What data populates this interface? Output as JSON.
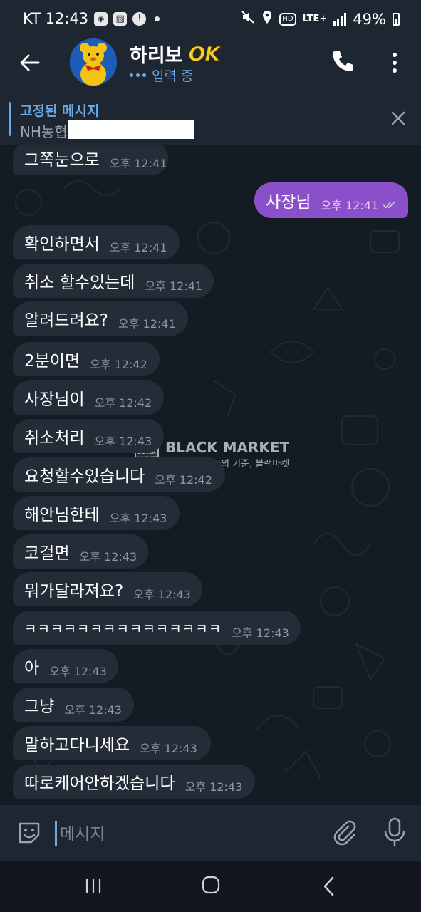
{
  "status_bar": {
    "carrier_time": "KT 12:43",
    "network": "LTE+",
    "hd": "HD",
    "battery": "49%"
  },
  "header": {
    "title": "하리보",
    "badge": "OK",
    "status": "입력 중"
  },
  "pinned": {
    "title": "고정된 메시지",
    "preview": "NH농협"
  },
  "messages": [
    {
      "text": "그쪽눈으로",
      "time": "오후 12:41"
    },
    {
      "text": "사장님",
      "time": "오후 12:41",
      "outgoing": true
    },
    {
      "text": "확인하면서",
      "time": "오후 12:41"
    },
    {
      "text": "취소 할수있는데",
      "time": "오후 12:41"
    },
    {
      "text": "알려드려요?",
      "time": "오후 12:41"
    },
    {
      "text": "2분이면",
      "time": "오후 12:42"
    },
    {
      "text": "사장님이",
      "time": "오후 12:42"
    },
    {
      "text": "취소처리",
      "time": "오후 12:43"
    },
    {
      "text": "요청할수있습니다",
      "time": "오후 12:42"
    },
    {
      "text": "해안님한테",
      "time": "오후 12:43"
    },
    {
      "text": "코걸면",
      "time": "오후 12:43"
    },
    {
      "text": "뭐가달라져요?",
      "time": "오후 12:43"
    },
    {
      "text": "ㅋㅋㅋㅋㅋㅋㅋㅋㅋㅋㅋㅋㅋㅋㅋ",
      "time": "오후 12:43"
    },
    {
      "text": "아",
      "time": "오후 12:43"
    },
    {
      "text": "그냥",
      "time": "오후 12:43"
    },
    {
      "text": "말하고다니세요",
      "time": "오후 12:43"
    },
    {
      "text": "따로케어안하겠습니다",
      "time": "오후 12:43"
    }
  ],
  "watermark": {
    "logo_text": "BLACK MARKET",
    "title": "BLACK MARKET",
    "subtitle": "정보의 기준, 블랙마켓"
  },
  "input": {
    "placeholder": "메시지"
  },
  "colors": {
    "accent": "#6aa9e6",
    "outgoing_bubble": "#8a4fc9",
    "incoming_bubble": "#232c37",
    "header": "#1e2632"
  }
}
